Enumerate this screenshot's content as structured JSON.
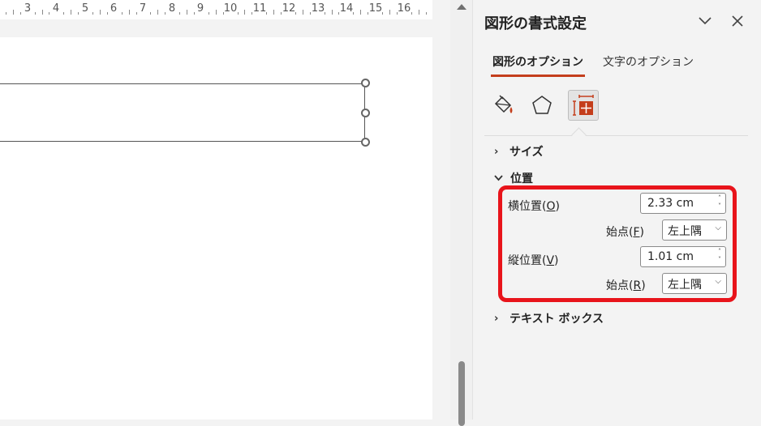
{
  "ruler": {
    "numbers": [
      "3",
      "4",
      "5",
      "6",
      "7",
      "8",
      "9",
      "10",
      "11",
      "12",
      "13",
      "14",
      "15",
      "16"
    ]
  },
  "pane": {
    "title": "図形の書式設定",
    "tabs": [
      {
        "label": "図形のオプション"
      },
      {
        "label": "文字のオプション"
      }
    ],
    "sections": {
      "size": {
        "label": "サイズ"
      },
      "position": {
        "label": "位置",
        "horizontal": {
          "label": "横位置(",
          "key": "O",
          "tail": ")",
          "value": "2.33 cm"
        },
        "h_from": {
          "label": "始点(",
          "key": "F",
          "tail": ")",
          "value": "左上隅"
        },
        "vertical": {
          "label": "縦位置(",
          "key": "V",
          "tail": ")",
          "value": "1.01 cm"
        },
        "v_from": {
          "label": "始点(",
          "key": "R",
          "tail": ")",
          "value": "左上隅"
        }
      },
      "textbox": {
        "label": "テキスト ボックス"
      }
    }
  },
  "colors": {
    "accent": "#c43e1c",
    "highlight": "#e8141b"
  }
}
